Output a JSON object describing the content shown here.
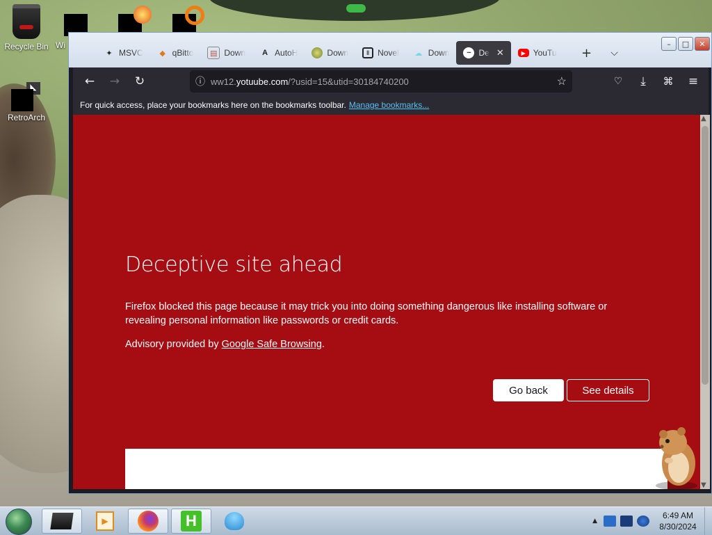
{
  "desktop": {
    "icons": [
      {
        "label": "Recycle Bin"
      },
      {
        "label": "Wi"
      },
      {
        "label": "RetroArch"
      }
    ]
  },
  "browser": {
    "tabs": [
      {
        "label": "MSVC",
        "icon": "msvc-icon"
      },
      {
        "label": "qBitto",
        "icon": "qbittorrent-icon"
      },
      {
        "label": "Down",
        "icon": "document-icon"
      },
      {
        "label": "AutoH",
        "icon": "autohotkey-icon"
      },
      {
        "label": "Down",
        "icon": "download-site-icon"
      },
      {
        "label": "Novel",
        "icon": "museum-icon"
      },
      {
        "label": "Down",
        "icon": "cloud-icon"
      },
      {
        "label": "De",
        "icon": "blocked-icon",
        "active": true
      },
      {
        "label": "YouTu",
        "icon": "youtube-icon"
      }
    ],
    "url": {
      "prefix": "ww12.",
      "host": "yotuube.com",
      "path": "/?usid=15&utid=30184740200"
    },
    "bookmarks_toolbar": {
      "message": "For quick access, place your bookmarks here on the bookmarks toolbar.",
      "link": "Manage bookmarks..."
    },
    "warning": {
      "title": "Deceptive site ahead",
      "body": "Firefox blocked this page because it may trick you into doing something dangerous like installing software or revealing personal information like passwords or credit cards.",
      "advisory_prefix": "Advisory provided by ",
      "advisory_link": "Google Safe Browsing",
      "advisory_suffix": ".",
      "go_back": "Go back",
      "see_details": "See details"
    },
    "colors": {
      "danger_bg": "#a50d12",
      "link": "#55c0f3",
      "toolbar": "#2b2a33"
    }
  },
  "taskbar": {
    "clock_time": "6:49 AM",
    "clock_date": "8/30/2024"
  }
}
